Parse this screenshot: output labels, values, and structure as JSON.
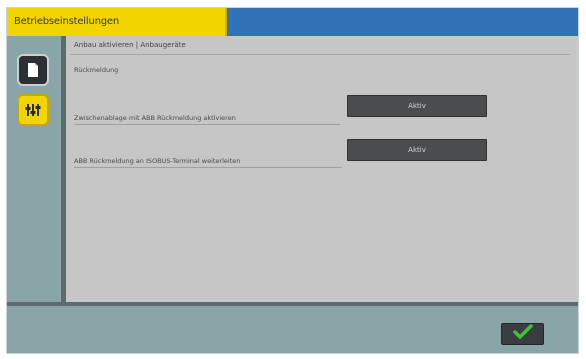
{
  "window": {
    "title": "Betriebseinstellungen"
  },
  "sidebar": {
    "items": [
      {
        "icon": "document-icon",
        "active": false
      },
      {
        "icon": "sliders-icon",
        "active": true
      }
    ]
  },
  "main": {
    "breadcrumb": "Anbau aktivieren | Anbaugeräte",
    "section_label": "Rückmeldung",
    "rows": [
      {
        "label": "Zwischenablage mit ABB Rückmeldung aktivieren",
        "button_label": "Aktiv"
      },
      {
        "label": "ABB Rückmeldung an ISOBUS-Terminal weiterleiten",
        "button_label": "Aktiv"
      }
    ]
  },
  "footer": {
    "ok_icon": "checkmark-icon"
  },
  "colors": {
    "title_tab": "#f2d400",
    "titlebar": "#2f72b8",
    "frame": "#8aa5a8",
    "content": "#c6c6c6",
    "button": "#4a4c4e",
    "ok_check": "#3cc43c"
  }
}
